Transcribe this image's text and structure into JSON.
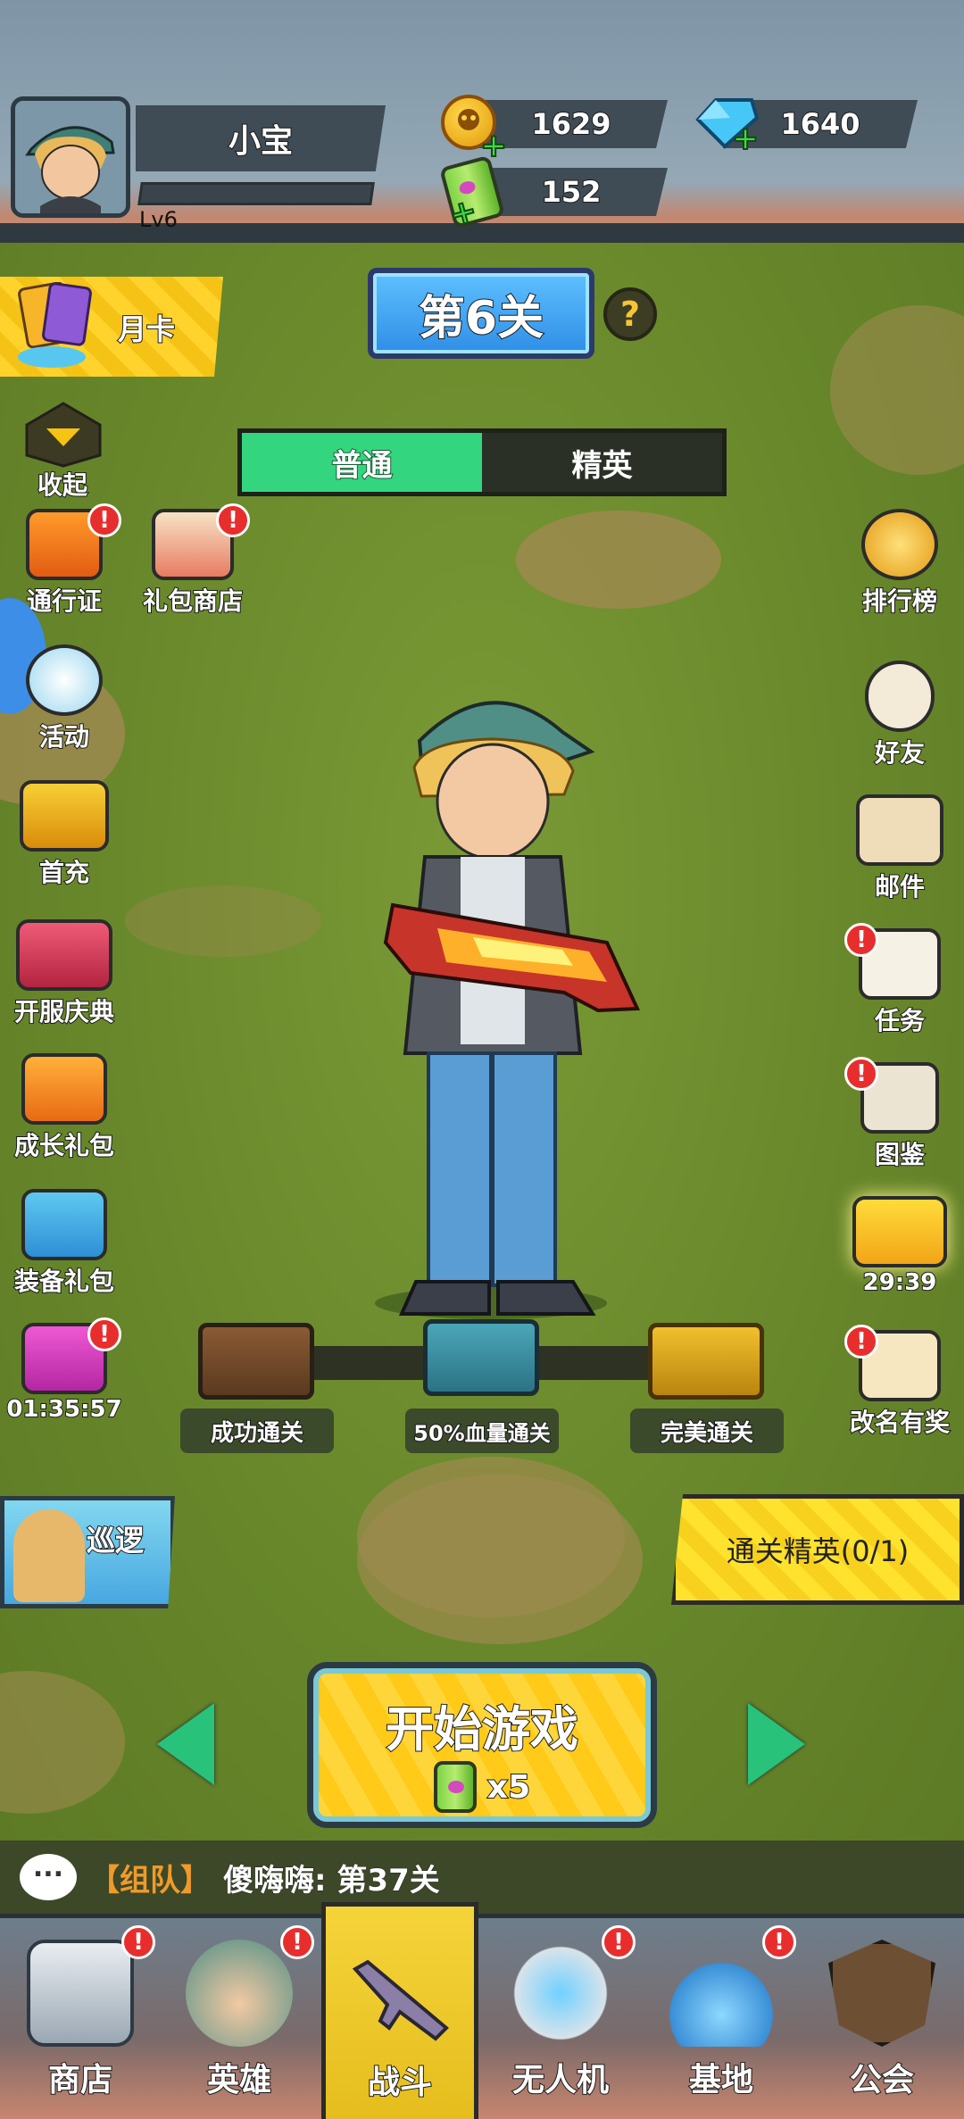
{
  "player": {
    "name": "小宝",
    "level": "Lv6",
    "gold": "1629",
    "gems": "1640",
    "energy": "152"
  },
  "stage": {
    "title": "第6关",
    "help": "?",
    "modes": [
      "普通",
      "精英"
    ],
    "active_mode": "普通"
  },
  "left_menu": {
    "month_card": "月卡",
    "collapse": "收起",
    "items": [
      {
        "label": "通行证",
        "badge": "!"
      },
      {
        "label": "礼包商店",
        "badge": "!"
      },
      {
        "label": "活动"
      },
      {
        "label": "首充"
      },
      {
        "label": "开服庆典"
      },
      {
        "label": "成长礼包"
      },
      {
        "label": "装备礼包"
      },
      {
        "label": "01:35:57",
        "badge": "!"
      }
    ]
  },
  "right_menu": {
    "items": [
      {
        "label": "排行榜"
      },
      {
        "label": "好友"
      },
      {
        "label": "邮件"
      },
      {
        "label": "任务",
        "badge": "!"
      },
      {
        "label": "图鉴",
        "badge": "!"
      },
      {
        "label": "29:39"
      },
      {
        "label": "改名有奖",
        "badge": "!"
      }
    ]
  },
  "rewards": [
    {
      "label": "成功通关"
    },
    {
      "label": "50%血量通关"
    },
    {
      "label": "完美通关"
    }
  ],
  "patrol_label": "巡逻",
  "elite_clear": "通关精英(0/1)",
  "start": {
    "label": "开始游戏",
    "cost": "x5"
  },
  "chat": {
    "channel": "【组队】",
    "message": "傻嗨嗨: 第37关"
  },
  "nav": [
    {
      "label": "商店",
      "badge": "!"
    },
    {
      "label": "英雄",
      "badge": "!"
    },
    {
      "label": "战斗"
    },
    {
      "label": "无人机",
      "badge": "!"
    },
    {
      "label": "基地",
      "badge": "!"
    },
    {
      "label": "公会"
    }
  ],
  "active_nav": "战斗",
  "colors": {
    "accent_yellow": "#ffd32c",
    "mode_active": "#33d67e",
    "badge_red": "#e82d2d",
    "stage_blue": "#2f8ee6"
  }
}
